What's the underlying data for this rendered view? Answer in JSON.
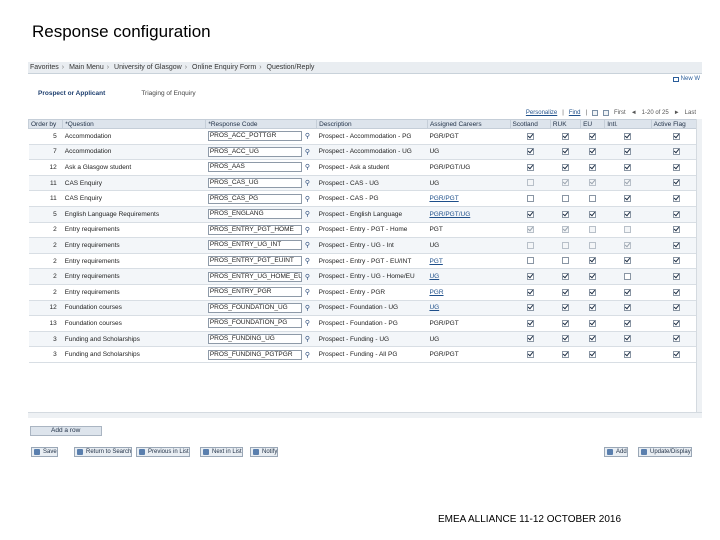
{
  "slide": {
    "title": "Response configuration",
    "footer": "EMEA ALLIANCE   11-12 OCTOBER 2016"
  },
  "breadcrumb": [
    "Favorites",
    "Main Menu",
    "University of Glasgow",
    "Online Enquiry Form",
    "Question/Reply"
  ],
  "new_window_label": "New W",
  "tabs": [
    {
      "label": "Prospect or Applicant",
      "active": true
    },
    {
      "label": "Triaging of Enquiry",
      "active": false
    }
  ],
  "grid_tools": {
    "personalize": "Personalize",
    "find": "Find",
    "first": "First",
    "range": "1-20 of 25",
    "last": "Last"
  },
  "columns": [
    "Order by",
    "*Question",
    "*Response Code",
    "Description",
    "Assigned Careers",
    "Scotland",
    "RUK",
    "EU",
    "Intl.",
    "Active Flag"
  ],
  "rows": [
    {
      "order": "5",
      "question": "Accommodation",
      "code": "PROS_ACC_POTTGR",
      "description": "Prospect - Accommodation - PG",
      "careers": "PGR/PGT",
      "careers_link": false,
      "scotland": true,
      "ruk": true,
      "eu": true,
      "intl": true,
      "active": true,
      "disabled": false
    },
    {
      "order": "7",
      "question": "Accommodation",
      "code": "PROS_ACC_UG",
      "description": "Prospect - Accommodation - UG",
      "careers": "UG",
      "careers_link": false,
      "scotland": true,
      "ruk": true,
      "eu": true,
      "intl": true,
      "active": true,
      "disabled": false
    },
    {
      "order": "12",
      "question": "Ask a Glasgow student",
      "code": "PROS_AAS",
      "description": "Prospect - Ask a student",
      "careers": "PGR/PGT/UG",
      "careers_link": false,
      "scotland": true,
      "ruk": true,
      "eu": true,
      "intl": true,
      "active": true,
      "disabled": false
    },
    {
      "order": "11",
      "question": "CAS Enquiry",
      "code": "PROS_CAS_UG",
      "description": "Prospect - CAS - UG",
      "careers": "UG",
      "careers_link": false,
      "scotland": false,
      "ruk": true,
      "eu": true,
      "intl": true,
      "active": true,
      "disabled": true
    },
    {
      "order": "11",
      "question": "CAS Enquiry",
      "code": "PROS_CAS_PG",
      "description": "Prospect - CAS - PG",
      "careers": "PGR/PGT",
      "careers_link": true,
      "scotland": false,
      "ruk": false,
      "eu": false,
      "intl": true,
      "active": true,
      "disabled": false
    },
    {
      "order": "5",
      "question": "English Language Requirements",
      "code": "PROS_ENGLANG",
      "description": "Prospect - English Language",
      "careers": "PGR/PGT/UG",
      "careers_link": true,
      "scotland": true,
      "ruk": true,
      "eu": true,
      "intl": true,
      "active": true,
      "disabled": false
    },
    {
      "order": "2",
      "question": "Entry requirements",
      "code": "PROS_ENTRY_PGT_HOME",
      "description": "Prospect - Entry - PGT - Home",
      "careers": "PGT",
      "careers_link": false,
      "scotland": true,
      "ruk": true,
      "eu": false,
      "intl": false,
      "active": true,
      "disabled": true
    },
    {
      "order": "2",
      "question": "Entry requirements",
      "code": "PROS_ENTRY_UG_INT",
      "description": "Prospect - Entry - UG - Int",
      "careers": "UG",
      "careers_link": false,
      "scotland": false,
      "ruk": false,
      "eu": false,
      "intl": true,
      "active": true,
      "disabled": true
    },
    {
      "order": "2",
      "question": "Entry requirements",
      "code": "PROS_ENTRY_PGT_EUINT",
      "description": "Prospect - Entry - PGT - EU/INT",
      "careers": "PGT",
      "careers_link": true,
      "scotland": false,
      "ruk": false,
      "eu": true,
      "intl": true,
      "active": true,
      "disabled": false
    },
    {
      "order": "2",
      "question": "Entry requirements",
      "code": "PROS_ENTRY_UG_HOME_EU",
      "description": "Prospect - Entry - UG - Home/EU",
      "careers": "UG",
      "careers_link": true,
      "scotland": true,
      "ruk": true,
      "eu": true,
      "intl": false,
      "active": true,
      "disabled": false
    },
    {
      "order": "2",
      "question": "Entry requirements",
      "code": "PROS_ENTRY_PGR",
      "description": "Prospect - Entry - PGR",
      "careers": "PGR",
      "careers_link": true,
      "scotland": true,
      "ruk": true,
      "eu": true,
      "intl": true,
      "active": true,
      "disabled": false
    },
    {
      "order": "12",
      "question": "Foundation courses",
      "code": "PROS_FOUNDATION_UG",
      "description": "Prospect - Foundation - UG",
      "careers": "UG",
      "careers_link": true,
      "scotland": true,
      "ruk": true,
      "eu": true,
      "intl": true,
      "active": true,
      "disabled": false
    },
    {
      "order": "13",
      "question": "Foundation courses",
      "code": "PROS_FOUNDATION_PG",
      "description": "Prospect - Foundation - PG",
      "careers": "PGR/PGT",
      "careers_link": false,
      "scotland": true,
      "ruk": true,
      "eu": true,
      "intl": true,
      "active": true,
      "disabled": false
    },
    {
      "order": "3",
      "question": "Funding and Scholarships",
      "code": "PROS_FUNDING_UG",
      "description": "Prospect - Funding - UG",
      "careers": "UG",
      "careers_link": false,
      "scotland": true,
      "ruk": true,
      "eu": true,
      "intl": true,
      "active": true,
      "disabled": false
    },
    {
      "order": "3",
      "question": "Funding and Scholarships",
      "code": "PROS_FUNDING_PGTPGR",
      "description": "Prospect - Funding - All PG",
      "careers": "PGR/PGT",
      "careers_link": false,
      "scotland": true,
      "ruk": true,
      "eu": true,
      "intl": true,
      "active": true,
      "disabled": false
    }
  ],
  "add_row_label": "Add a row",
  "buttons": {
    "save": "Save",
    "return_to_search": "Return to Search",
    "previous_in_list": "Previous in List",
    "next_in_list": "Next in List",
    "notify": "Notify",
    "add": "Add",
    "update_display": "Update/Display"
  }
}
